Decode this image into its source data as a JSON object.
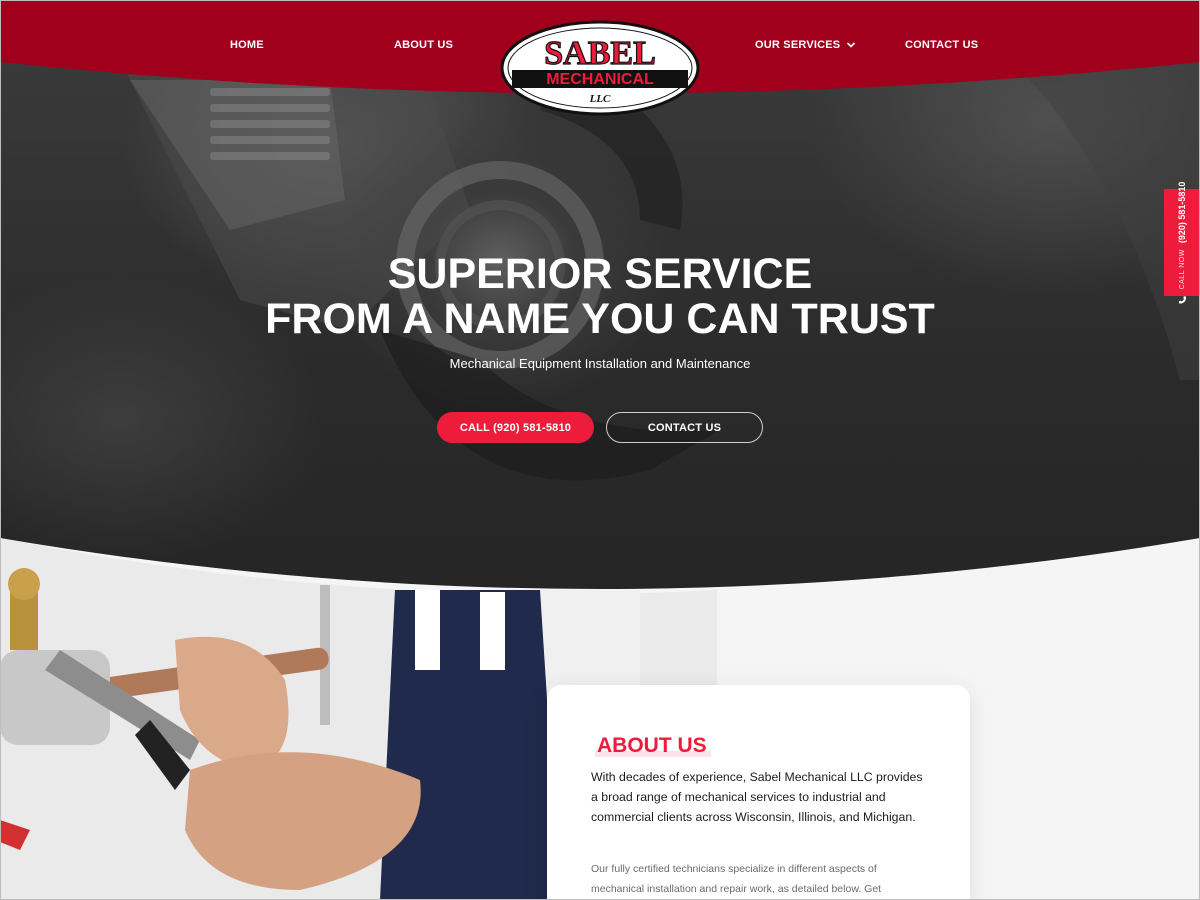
{
  "nav": {
    "home": "HOME",
    "about": "ABOUT US",
    "services": "OUR SERVICES",
    "contact": "CONTACT US"
  },
  "logo": {
    "line1": "SABEL",
    "line2": "MECHANICAL",
    "line3": "LLC"
  },
  "hero": {
    "title_line1": "SUPERIOR SERVICE",
    "title_line2": "FROM A NAME YOU CAN TRUST",
    "subtitle": "Mechanical Equipment Installation and Maintenance",
    "call_button": "CALL (920) 581-5810",
    "contact_button": "CONTACT US"
  },
  "call_tab": {
    "label": "CALL NOW",
    "number": "(920) 581-5810"
  },
  "about": {
    "title": "ABOUT US",
    "lead": "With decades of experience, Sabel Mechanical LLC provides a broad range of mechanical services to industrial and commercial clients across Wisconsin, Illinois, and Michigan.",
    "body": "Our fully certified technicians specialize in different aspects of mechanical installation and repair work, as detailed below. Get"
  },
  "colors": {
    "brand_red": "#ee1c3b",
    "nav_red": "#a1001d",
    "hero_dark": "#2b2b2b"
  },
  "icons": [
    "chevron-down-icon",
    "phone-icon"
  ]
}
